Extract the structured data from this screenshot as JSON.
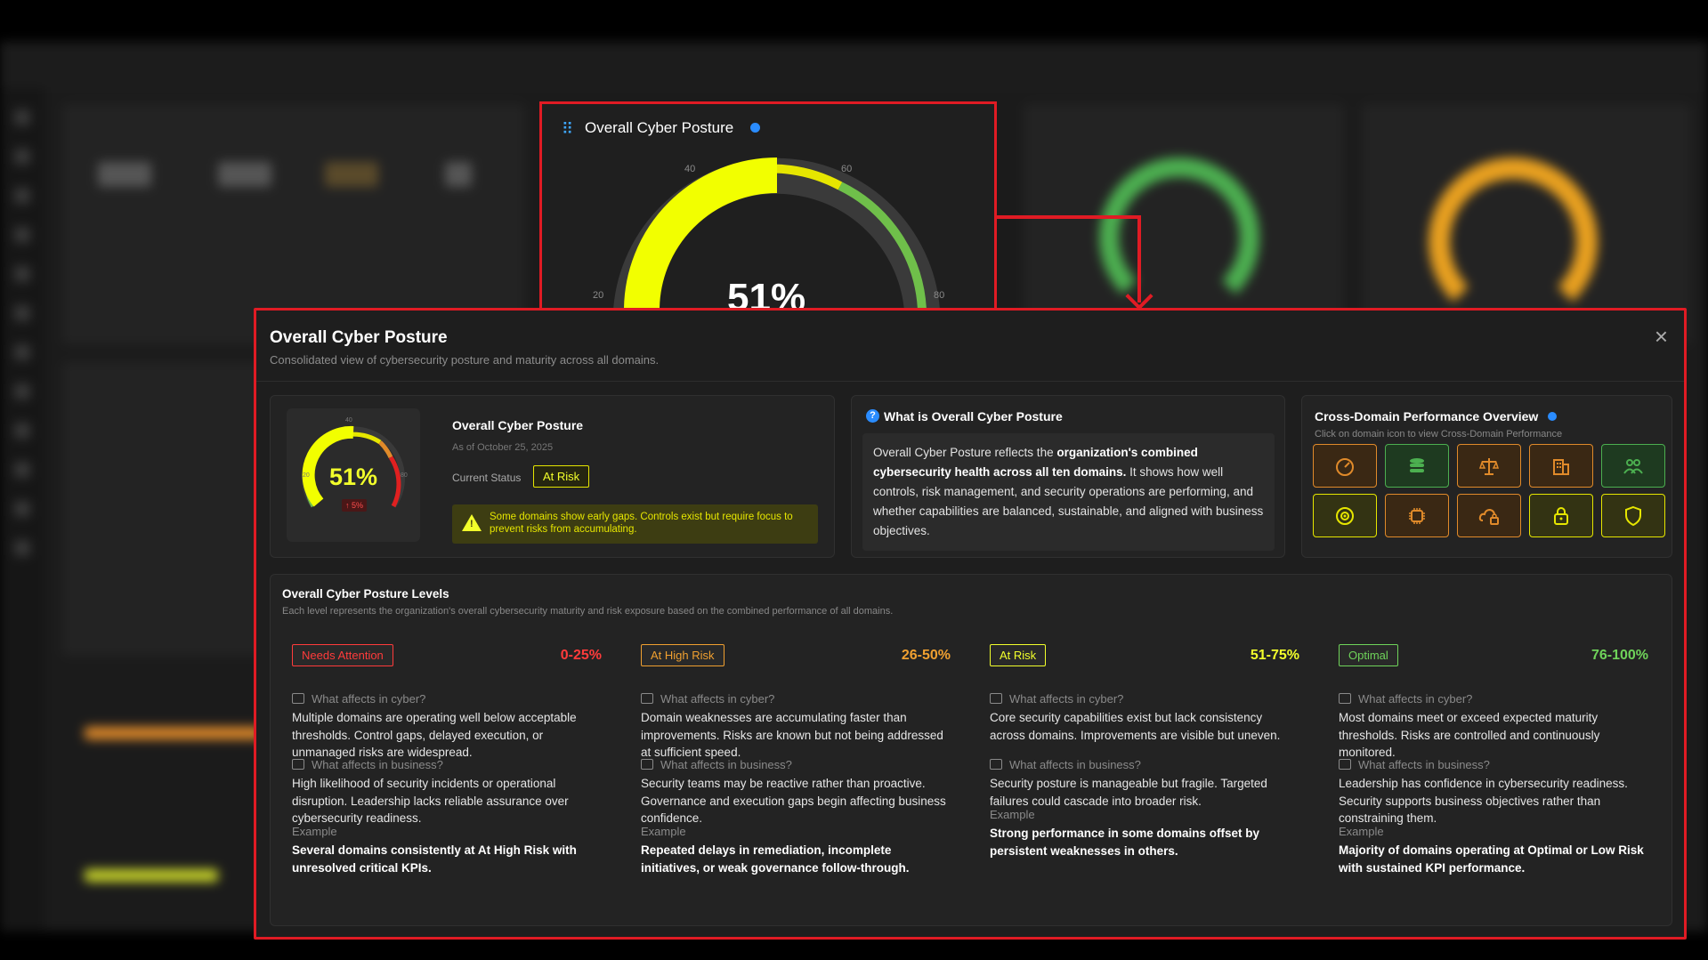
{
  "zoom_card": {
    "title": "Overall Cyber Posture",
    "percent": "51%",
    "ticks": [
      "20",
      "40",
      "60",
      "80"
    ]
  },
  "modal": {
    "title": "Overall Cyber Posture",
    "subtitle": "Consolidated view of cybersecurity posture and maturity across all domains.",
    "close": "×"
  },
  "summary": {
    "title": "Overall Cyber Posture",
    "date": "As of October 25, 2025",
    "status_label": "Current Status",
    "status": "At Risk",
    "gauge_value": 51,
    "percent": "51%",
    "delta": "↑ 5%",
    "warning": "Some domains show early gaps. Controls exist but require focus to prevent risks from accumulating."
  },
  "what_is": {
    "title": "What is Overall Cyber Posture",
    "body_1": "Overall Cyber Posture reflects the ",
    "body_bold": "organization's combined cybersecurity health across all ten domains.",
    "body_2": " It shows how well controls, risk management, and security operations are performing, and whether capabilities are balanced, sustainable, and aligned with business objectives."
  },
  "cross_domain": {
    "title": "Cross-Domain Performance Overview",
    "subtitle": "Click on domain icon to view Cross-Domain Performance",
    "domains": [
      {
        "icon": "speedometer-icon",
        "color": "#e08a2a"
      },
      {
        "icon": "database-icon",
        "color": "#4caf50"
      },
      {
        "icon": "scales-icon",
        "color": "#e08a2a"
      },
      {
        "icon": "building-icon",
        "color": "#e08a2a"
      },
      {
        "icon": "users-icon",
        "color": "#4caf50"
      },
      {
        "icon": "target-icon",
        "color": "#e6e600"
      },
      {
        "icon": "chip-icon",
        "color": "#e08a2a"
      },
      {
        "icon": "cloud-lock-icon",
        "color": "#e08a2a"
      },
      {
        "icon": "lock-icon",
        "color": "#e6e600"
      },
      {
        "icon": "shield-icon",
        "color": "#e6e600"
      }
    ]
  },
  "levels": {
    "title": "Overall Cyber Posture Levels",
    "subtitle": "Each level represents the organization's overall cybersecurity maturity and risk exposure based on the combined performance of all domains.",
    "cyber_heading": "What affects in cyber?",
    "business_heading": "What affects in business?",
    "example_heading": "Example",
    "items": [
      {
        "name": "Needs Attention",
        "range": "0-25%",
        "color": "#ff3b3b",
        "cyber": "Multiple domains are operating well below acceptable thresholds. Control gaps, delayed execution, or unmanaged risks are widespread.",
        "business": "High likelihood of security incidents or operational disruption. Leadership lacks reliable assurance over cybersecurity readiness.",
        "example": "Several domains consistently at At High Risk with unresolved critical KPIs."
      },
      {
        "name": "At High Risk",
        "range": "26-50%",
        "color": "#f0a030",
        "cyber": "Domain weaknesses are accumulating faster than improvements. Risks are known but not being addressed at sufficient speed.",
        "business": "Security teams may be reactive rather than proactive. Governance and execution gaps begin affecting business confidence.",
        "example": "Repeated delays in remediation, incomplete initiatives, or weak governance follow-through."
      },
      {
        "name": "At Risk",
        "range": "51-75%",
        "color": "#f2ff2b",
        "cyber": "Core security capabilities exist but lack consistency across domains. Improvements are visible but uneven.",
        "business": "Security posture is manageable but fragile. Targeted failures could cascade into broader risk.",
        "example": "Strong performance in some domains offset by persistent weaknesses in others."
      },
      {
        "name": "Optimal",
        "range": "76-100%",
        "color": "#6fd35a",
        "cyber": "Most domains meet or exceed expected maturity thresholds. Risks are controlled and continuously monitored.",
        "business": "Leadership has confidence in cybersecurity readiness. Security supports business objectives rather than constraining them.",
        "example": "Majority of domains operating at Optimal or Low Risk with sustained KPI performance."
      }
    ]
  }
}
